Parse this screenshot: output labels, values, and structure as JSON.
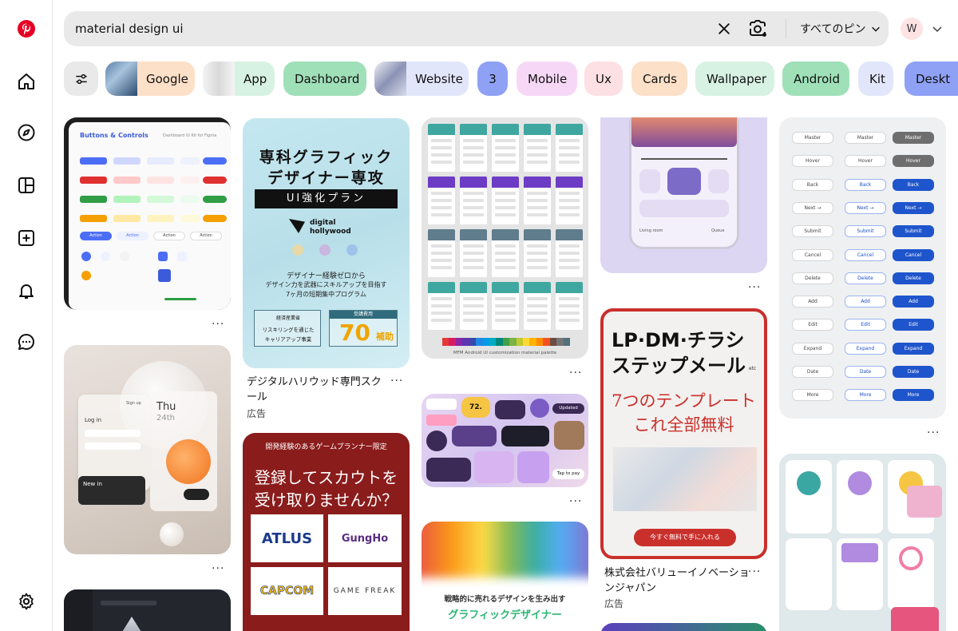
{
  "search": {
    "query": "material design ui",
    "scope_label": "すべてのピン"
  },
  "account": {
    "initial": "W"
  },
  "chips": [
    {
      "label": "Google",
      "bg": "#fde0c8"
    },
    {
      "label": "App",
      "bg": "#d7f2e2"
    },
    {
      "label": "Dashboard",
      "bg": "#9fe0b8"
    },
    {
      "label": "Website",
      "bg": "#e2e6fb"
    },
    {
      "label": "3",
      "bg": "#8fa1f5"
    },
    {
      "label": "Mobile",
      "bg": "#f6d8f6"
    },
    {
      "label": "Ux",
      "bg": "#fde0e3"
    },
    {
      "label": "Cards",
      "bg": "#fde0c8"
    },
    {
      "label": "Wallpaper",
      "bg": "#d7f2e2"
    },
    {
      "label": "Android",
      "bg": "#9fe0b8"
    },
    {
      "label": "Kit",
      "bg": "#e2e6fb"
    },
    {
      "label": "Deskt",
      "bg": "#8fa1f5"
    }
  ],
  "pins": {
    "buttons": {
      "heading": "Buttons & Controls",
      "subheading": "Dashboard UI Kit for Figma",
      "row_labels": [
        "Action",
        "Action",
        "Action",
        "Action"
      ]
    },
    "glass": {
      "card_day": "Thu",
      "card_date": "24th",
      "login_label": "Log in",
      "newin_label": "New in",
      "signup_label": "Sign up"
    },
    "ad_dh": {
      "headline_1": "専科グラフィック",
      "headline_2": "デザイナー専攻",
      "band": "UI強化プラン",
      "brand_1": "digital",
      "brand_2": "hollywood",
      "copy_1": "デザイナー経験ゼロから",
      "copy_2": "デザイン力を武器にスキルアップを目指す",
      "copy_3": "7ヶ月の短期集中プログラム",
      "box_left_1": "経済産業省",
      "box_left_2": "リスキリングを通じた",
      "box_left_3": "キャリアアップ事業",
      "box_right_1": "受講費用",
      "box_right_num": "70",
      "box_right_2": "補助",
      "title": "デジタルハリウッド専門スクール",
      "ad": "広告"
    },
    "ad_game": {
      "top": "開発経験のあるゲームプランナー限定",
      "headline_1": "登録してスカウトを",
      "headline_2": "受け取りませんか？",
      "logos": [
        "ATLUS",
        "GungHo",
        "CAPCOM",
        "GAME FREAK"
      ]
    },
    "android": {
      "caption": "MFM Android UI customization material palette"
    },
    "widgets": {
      "temp": "72.",
      "updated": "Updated",
      "tap": "Tap to pay"
    },
    "gradient": {
      "line_1": "戦略的に売れるデザインを生み出す",
      "line_2": "グラフィックデザイナー"
    },
    "phone": {
      "left": "Living room",
      "right": "Queue"
    },
    "ad_lp": {
      "headline_1": "LP·DM·チラシ",
      "headline_2": "ステップメール",
      "etc": "etc",
      "sub_1": "7つのテンプレート",
      "sub_2": "これ全部無料",
      "cta": "今すぐ無料で手に入れる",
      "title": "株式会社バリューイノベーションジャパン",
      "ad": "広告"
    },
    "btnlist": {
      "rows": [
        "Master",
        "Hover",
        "Back",
        "Next →",
        "Submit",
        "Cancel",
        "Delete",
        "Add",
        "Edit",
        "Expand",
        "Date",
        "More"
      ]
    }
  },
  "colors": {
    "brand": "#e60023",
    "dh_bg": "#bfe3ec",
    "game_bg": "#8b1c1c",
    "lp_border": "#c9302c",
    "android_purple": "#6c3cc4",
    "android_teal": "#3fa7a0"
  },
  "icons": {
    "logo": "pinterest-logo",
    "home": "home-icon",
    "explore": "compass-icon",
    "boards": "boards-icon",
    "create": "plus-icon",
    "notifications": "bell-icon",
    "messages": "chat-icon",
    "settings": "gear-icon"
  }
}
